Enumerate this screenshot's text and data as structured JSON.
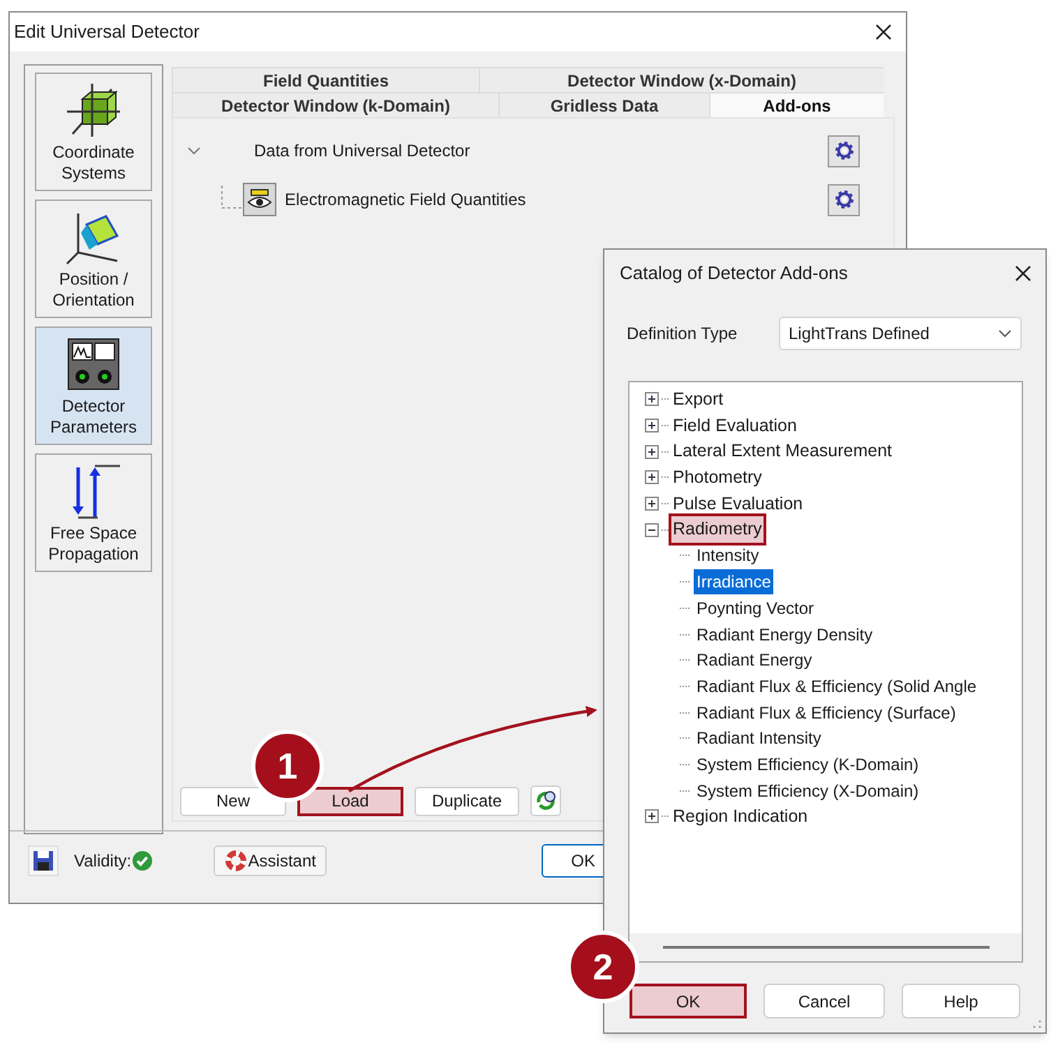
{
  "main_window": {
    "title": "Edit Universal Detector",
    "sidebar": [
      {
        "label": "Coordinate Systems",
        "kind": "coordinates",
        "selected": false
      },
      {
        "label": "Position / Orientation",
        "kind": "position",
        "selected": false
      },
      {
        "label": "Detector Parameters",
        "kind": "detector",
        "selected": true
      },
      {
        "label": "Free Space Propagation",
        "kind": "propagation",
        "selected": false
      }
    ],
    "tab_rows": [
      [
        {
          "label": "Field Quantities",
          "selected": false
        },
        {
          "label": "Detector Window (x-Domain)",
          "selected": false
        }
      ],
      [
        {
          "label": "Detector Window (k-Domain)",
          "selected": false
        },
        {
          "label": "Gridless Data",
          "selected": false
        },
        {
          "label": "Add-ons",
          "selected": true
        }
      ]
    ],
    "addon_tree": {
      "label": "Data from Universal Detector",
      "expanded": true,
      "children": [
        {
          "label": "Electromagnetic Field Quantities"
        }
      ]
    },
    "buttons": [
      {
        "label": "New",
        "highlighted": false
      },
      {
        "label": "Load",
        "highlighted": true
      },
      {
        "label": "Duplicate",
        "highlighted": false
      }
    ],
    "validity": {
      "label": "Validity:",
      "valid": true
    },
    "assistant": "Assistant",
    "ok": "OK"
  },
  "dialog": {
    "title": "Catalog of Detector Add-ons",
    "definition_type": {
      "label": "Definition Type",
      "value": "LightTrans Defined"
    },
    "tree": [
      {
        "label": "Export",
        "expanded": false,
        "highlighted": false
      },
      {
        "label": "Field Evaluation",
        "expanded": false,
        "highlighted": false
      },
      {
        "label": "Lateral Extent Measurement",
        "expanded": false,
        "highlighted": false
      },
      {
        "label": "Photometry",
        "expanded": false,
        "highlighted": false
      },
      {
        "label": "Pulse Evaluation",
        "expanded": false,
        "highlighted": false
      },
      {
        "label": "Radiometry",
        "expanded": true,
        "highlighted": true,
        "children": [
          {
            "label": "Intensity",
            "selected": false
          },
          {
            "label": "Irradiance",
            "selected": true
          },
          {
            "label": "Poynting Vector",
            "selected": false
          },
          {
            "label": "Radiant Energy Density",
            "selected": false
          },
          {
            "label": "Radiant Energy",
            "selected": false
          },
          {
            "label": "Radiant Flux & Efficiency (Solid Angle",
            "selected": false
          },
          {
            "label": "Radiant Flux & Efficiency (Surface)",
            "selected": false
          },
          {
            "label": "Radiant Intensity",
            "selected": false
          },
          {
            "label": "System Efficiency (K-Domain)",
            "selected": false
          },
          {
            "label": "System Efficiency (X-Domain)",
            "selected": false
          }
        ]
      },
      {
        "label": "Region Indication",
        "expanded": false,
        "highlighted": false
      }
    ],
    "buttons": [
      {
        "label": "OK",
        "highlighted": true
      },
      {
        "label": "Cancel",
        "highlighted": false
      },
      {
        "label": "Help",
        "highlighted": false
      }
    ]
  },
  "callouts": [
    {
      "number": "1"
    },
    {
      "number": "2"
    }
  ]
}
